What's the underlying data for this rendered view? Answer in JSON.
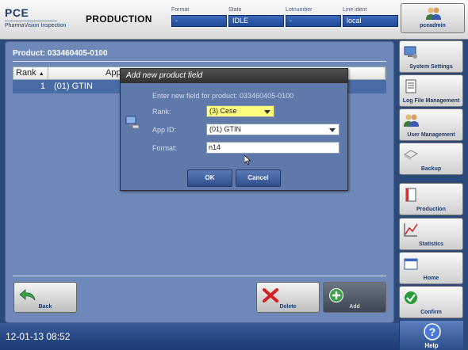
{
  "header": {
    "logo_title": "PCE",
    "logo_subtitle": "PharmaVision Inspection",
    "app_title": "PRODUCTION",
    "fields": [
      {
        "label": "Format",
        "value": "-"
      },
      {
        "label": "State",
        "value": "IDLE"
      },
      {
        "label": "Lotnumber",
        "value": "-"
      },
      {
        "label": "Line ident",
        "value": "local"
      }
    ],
    "user": {
      "name": "pceadmin",
      "icon": "users-icon"
    }
  },
  "main": {
    "product_title": "Product: 033460405-0100",
    "table": {
      "columns": [
        "Rank",
        "App"
      ],
      "rows": [
        {
          "rank": "1",
          "app": "(01) GTIN"
        }
      ]
    },
    "back_label": "Back",
    "delete_label": "Delete",
    "add_label": "Add"
  },
  "dialog": {
    "title": "Add new product field",
    "instruction": "Enter new field for product: 033460405-0100",
    "rank_label": "Rank:",
    "rank_value": "(3) Cese",
    "appid_label": "App ID:",
    "appid_value": "(01) GTIN",
    "format_label": "Format:",
    "format_value": "n14",
    "ok_label": "OK",
    "cancel_label": "Cancel"
  },
  "sidebar": {
    "items": [
      {
        "label": "System Settings",
        "icon": "monitor-settings-icon"
      },
      {
        "label": "Log File Management",
        "icon": "log-file-icon"
      },
      {
        "label": "User Management",
        "icon": "users-icon"
      },
      {
        "label": "Backup",
        "icon": "backup-disk-icon"
      },
      {
        "label": "Production",
        "icon": "document-icon"
      },
      {
        "label": "Statistics",
        "icon": "chart-icon"
      },
      {
        "label": "Home",
        "icon": "window-icon"
      },
      {
        "label": "Confirm",
        "icon": "check-icon"
      }
    ],
    "help_label": "Help"
  },
  "footer": {
    "datetime": "12-01-13 08:52"
  },
  "colors": {
    "panel": "#6e88ba",
    "header_field": "#2a58a8",
    "rank_highlight": "#ffff80"
  }
}
